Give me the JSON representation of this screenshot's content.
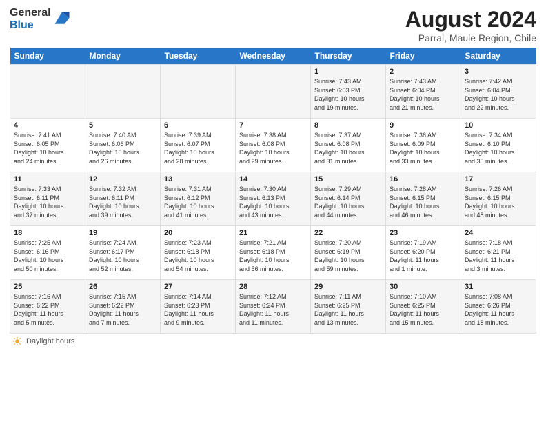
{
  "logo": {
    "general": "General",
    "blue": "Blue"
  },
  "title": "August 2024",
  "location": "Parral, Maule Region, Chile",
  "weekdays": [
    "Sunday",
    "Monday",
    "Tuesday",
    "Wednesday",
    "Thursday",
    "Friday",
    "Saturday"
  ],
  "weeks": [
    [
      {
        "day": "",
        "info": ""
      },
      {
        "day": "",
        "info": ""
      },
      {
        "day": "",
        "info": ""
      },
      {
        "day": "",
        "info": ""
      },
      {
        "day": "1",
        "info": "Sunrise: 7:43 AM\nSunset: 6:03 PM\nDaylight: 10 hours\nand 19 minutes."
      },
      {
        "day": "2",
        "info": "Sunrise: 7:43 AM\nSunset: 6:04 PM\nDaylight: 10 hours\nand 21 minutes."
      },
      {
        "day": "3",
        "info": "Sunrise: 7:42 AM\nSunset: 6:04 PM\nDaylight: 10 hours\nand 22 minutes."
      }
    ],
    [
      {
        "day": "4",
        "info": "Sunrise: 7:41 AM\nSunset: 6:05 PM\nDaylight: 10 hours\nand 24 minutes."
      },
      {
        "day": "5",
        "info": "Sunrise: 7:40 AM\nSunset: 6:06 PM\nDaylight: 10 hours\nand 26 minutes."
      },
      {
        "day": "6",
        "info": "Sunrise: 7:39 AM\nSunset: 6:07 PM\nDaylight: 10 hours\nand 28 minutes."
      },
      {
        "day": "7",
        "info": "Sunrise: 7:38 AM\nSunset: 6:08 PM\nDaylight: 10 hours\nand 29 minutes."
      },
      {
        "day": "8",
        "info": "Sunrise: 7:37 AM\nSunset: 6:08 PM\nDaylight: 10 hours\nand 31 minutes."
      },
      {
        "day": "9",
        "info": "Sunrise: 7:36 AM\nSunset: 6:09 PM\nDaylight: 10 hours\nand 33 minutes."
      },
      {
        "day": "10",
        "info": "Sunrise: 7:34 AM\nSunset: 6:10 PM\nDaylight: 10 hours\nand 35 minutes."
      }
    ],
    [
      {
        "day": "11",
        "info": "Sunrise: 7:33 AM\nSunset: 6:11 PM\nDaylight: 10 hours\nand 37 minutes."
      },
      {
        "day": "12",
        "info": "Sunrise: 7:32 AM\nSunset: 6:11 PM\nDaylight: 10 hours\nand 39 minutes."
      },
      {
        "day": "13",
        "info": "Sunrise: 7:31 AM\nSunset: 6:12 PM\nDaylight: 10 hours\nand 41 minutes."
      },
      {
        "day": "14",
        "info": "Sunrise: 7:30 AM\nSunset: 6:13 PM\nDaylight: 10 hours\nand 43 minutes."
      },
      {
        "day": "15",
        "info": "Sunrise: 7:29 AM\nSunset: 6:14 PM\nDaylight: 10 hours\nand 44 minutes."
      },
      {
        "day": "16",
        "info": "Sunrise: 7:28 AM\nSunset: 6:15 PM\nDaylight: 10 hours\nand 46 minutes."
      },
      {
        "day": "17",
        "info": "Sunrise: 7:26 AM\nSunset: 6:15 PM\nDaylight: 10 hours\nand 48 minutes."
      }
    ],
    [
      {
        "day": "18",
        "info": "Sunrise: 7:25 AM\nSunset: 6:16 PM\nDaylight: 10 hours\nand 50 minutes."
      },
      {
        "day": "19",
        "info": "Sunrise: 7:24 AM\nSunset: 6:17 PM\nDaylight: 10 hours\nand 52 minutes."
      },
      {
        "day": "20",
        "info": "Sunrise: 7:23 AM\nSunset: 6:18 PM\nDaylight: 10 hours\nand 54 minutes."
      },
      {
        "day": "21",
        "info": "Sunrise: 7:21 AM\nSunset: 6:18 PM\nDaylight: 10 hours\nand 56 minutes."
      },
      {
        "day": "22",
        "info": "Sunrise: 7:20 AM\nSunset: 6:19 PM\nDaylight: 10 hours\nand 59 minutes."
      },
      {
        "day": "23",
        "info": "Sunrise: 7:19 AM\nSunset: 6:20 PM\nDaylight: 11 hours\nand 1 minute."
      },
      {
        "day": "24",
        "info": "Sunrise: 7:18 AM\nSunset: 6:21 PM\nDaylight: 11 hours\nand 3 minutes."
      }
    ],
    [
      {
        "day": "25",
        "info": "Sunrise: 7:16 AM\nSunset: 6:22 PM\nDaylight: 11 hours\nand 5 minutes."
      },
      {
        "day": "26",
        "info": "Sunrise: 7:15 AM\nSunset: 6:22 PM\nDaylight: 11 hours\nand 7 minutes."
      },
      {
        "day": "27",
        "info": "Sunrise: 7:14 AM\nSunset: 6:23 PM\nDaylight: 11 hours\nand 9 minutes."
      },
      {
        "day": "28",
        "info": "Sunrise: 7:12 AM\nSunset: 6:24 PM\nDaylight: 11 hours\nand 11 minutes."
      },
      {
        "day": "29",
        "info": "Sunrise: 7:11 AM\nSunset: 6:25 PM\nDaylight: 11 hours\nand 13 minutes."
      },
      {
        "day": "30",
        "info": "Sunrise: 7:10 AM\nSunset: 6:25 PM\nDaylight: 11 hours\nand 15 minutes."
      },
      {
        "day": "31",
        "info": "Sunrise: 7:08 AM\nSunset: 6:26 PM\nDaylight: 11 hours\nand 18 minutes."
      }
    ]
  ],
  "legend": {
    "daylight_hours": "Daylight hours"
  }
}
